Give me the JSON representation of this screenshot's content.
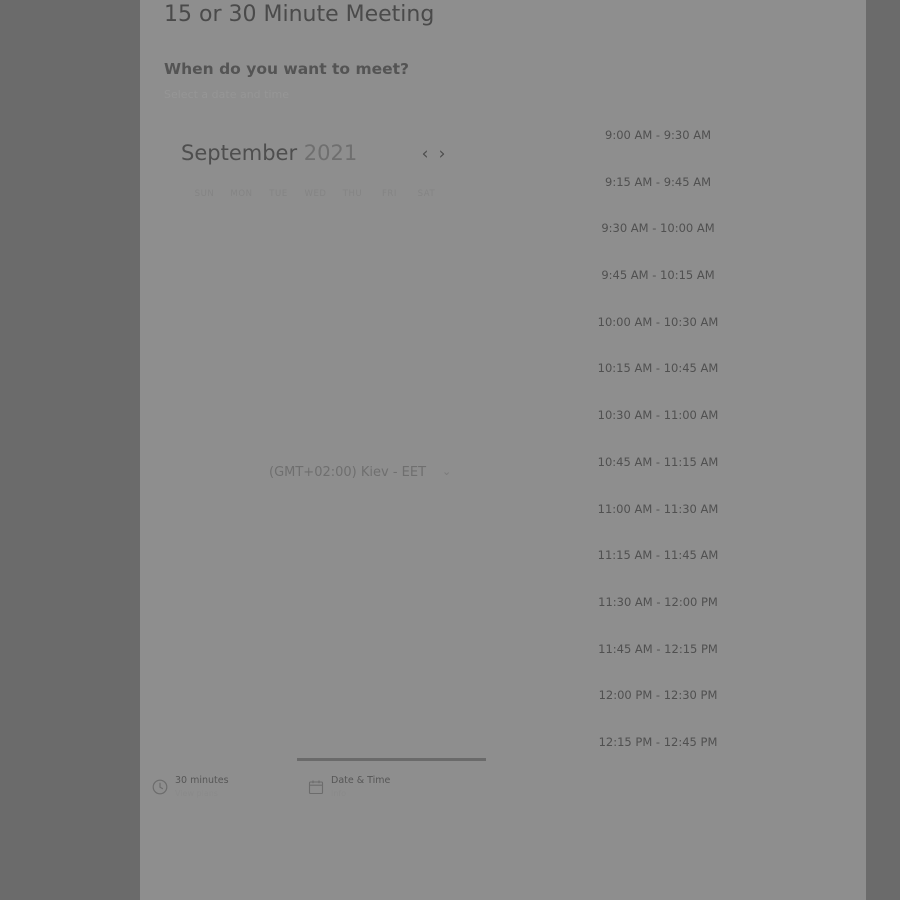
{
  "meeting": {
    "title": "15 or 30 Minute Meeting",
    "question": "When do you want to meet?",
    "hint": "Select a date and time"
  },
  "calendar": {
    "month": "September",
    "year": "2021",
    "weekdays": [
      "SUN",
      "MON",
      "TUE",
      "WED",
      "THU",
      "FRI",
      "SAT"
    ],
    "prev_icon": "chevron-left-icon",
    "next_icon": "chevron-right-icon"
  },
  "timezone": {
    "label": "(GMT+02:00) Kiev - EET",
    "icon": "chevron-down-icon"
  },
  "time_slots": [
    "9:00 AM - 9:30 AM",
    "9:15 AM - 9:45 AM",
    "9:30 AM - 10:00 AM",
    "9:45 AM - 10:15 AM",
    "10:00 AM - 10:30 AM",
    "10:15 AM - 10:45 AM",
    "10:30 AM - 11:00 AM",
    "10:45 AM - 11:15 AM",
    "11:00 AM - 11:30 AM",
    "11:15 AM - 11:45 AM",
    "11:30 AM - 12:00 PM",
    "11:45 AM - 12:15 PM",
    "12:00 PM - 12:30 PM",
    "12:15 PM - 12:45 PM"
  ],
  "steps": {
    "duration": {
      "label": "30 minutes",
      "sub": "View plans",
      "icon": "clock-icon"
    },
    "datetime": {
      "label": "Date & Time",
      "sub": "Info",
      "icon": "calendar-icon"
    }
  },
  "colors": {
    "overlay_background": "#6b6b6b",
    "panel_background": "#8e8e8e",
    "progress_line": "#6a6a6a"
  }
}
